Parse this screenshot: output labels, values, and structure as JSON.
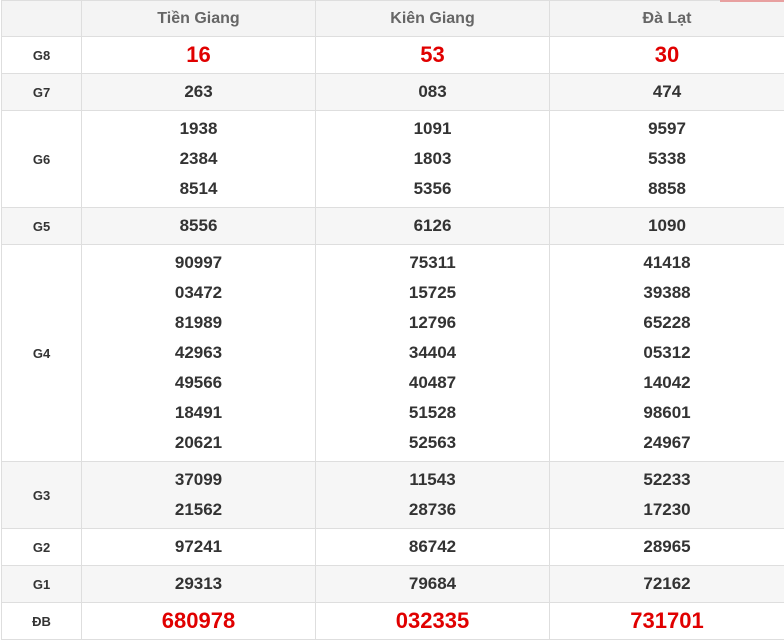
{
  "columns": [
    "Tiền Giang",
    "Kiên Giang",
    "Đà Lạt"
  ],
  "prizes": [
    {
      "label": "G8",
      "values": [
        [
          "16"
        ],
        [
          "53"
        ],
        [
          "30"
        ]
      ]
    },
    {
      "label": "G7",
      "values": [
        [
          "263"
        ],
        [
          "083"
        ],
        [
          "474"
        ]
      ]
    },
    {
      "label": "G6",
      "values": [
        [
          "1938",
          "2384",
          "8514"
        ],
        [
          "1091",
          "1803",
          "5356"
        ],
        [
          "9597",
          "5338",
          "8858"
        ]
      ]
    },
    {
      "label": "G5",
      "values": [
        [
          "8556"
        ],
        [
          "6126"
        ],
        [
          "1090"
        ]
      ]
    },
    {
      "label": "G4",
      "values": [
        [
          "90997",
          "03472",
          "81989",
          "42963",
          "49566",
          "18491",
          "20621"
        ],
        [
          "75311",
          "15725",
          "12796",
          "34404",
          "40487",
          "51528",
          "52563"
        ],
        [
          "41418",
          "39388",
          "65228",
          "05312",
          "14042",
          "98601",
          "24967"
        ]
      ]
    },
    {
      "label": "G3",
      "values": [
        [
          "37099",
          "21562"
        ],
        [
          "11543",
          "28736"
        ],
        [
          "52233",
          "17230"
        ]
      ]
    },
    {
      "label": "G2",
      "values": [
        [
          "97241"
        ],
        [
          "86742"
        ],
        [
          "28965"
        ]
      ]
    },
    {
      "label": "G1",
      "values": [
        [
          "29313"
        ],
        [
          "79684"
        ],
        [
          "72162"
        ]
      ]
    },
    {
      "label": "ĐB",
      "values": [
        [
          "680978"
        ],
        [
          "032335"
        ],
        [
          "731701"
        ]
      ]
    }
  ],
  "colors": {
    "highlight": "#e00000",
    "text": "#333333",
    "header_text": "#666666",
    "zebra": "#f6f6f6",
    "border": "#dedede"
  }
}
